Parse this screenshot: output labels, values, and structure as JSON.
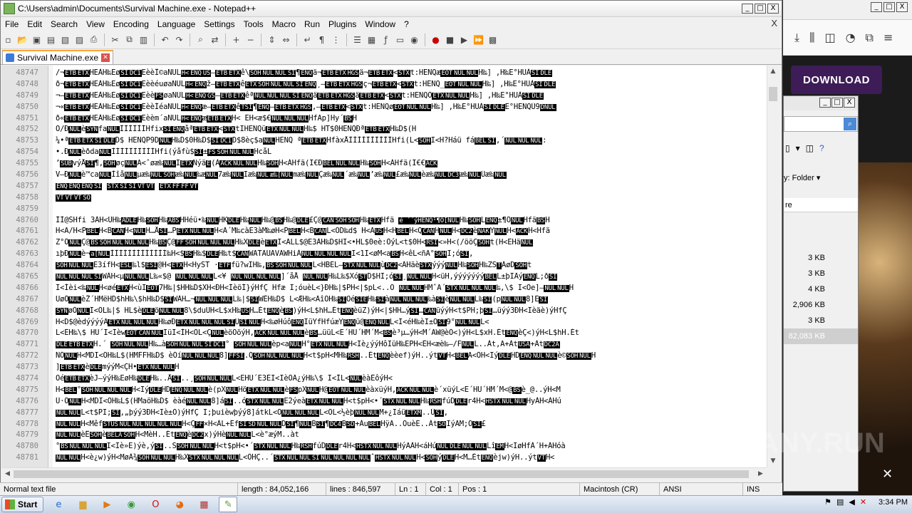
{
  "window": {
    "title": "C:\\Users\\admin\\Documents\\Survival Machine.exe - Notepad++",
    "controls": [
      "_",
      "□",
      "X"
    ]
  },
  "menu": [
    "File",
    "Edit",
    "Search",
    "View",
    "Encoding",
    "Language",
    "Settings",
    "Tools",
    "Macro",
    "Run",
    "Plugins",
    "Window",
    "?"
  ],
  "menu_close": "X",
  "toolbar_icons": [
    "new-icon",
    "open-icon",
    "save-icon",
    "save-all-icon",
    "close-icon",
    "close-all-icon",
    "print-icon",
    "cut-icon",
    "copy-icon",
    "paste-icon",
    "undo-icon",
    "redo-icon",
    "find-icon",
    "replace-icon",
    "zoom-in-icon",
    "zoom-out-icon",
    "sync-v-icon",
    "sync-h-icon",
    "wrap-icon",
    "all-chars-icon",
    "indent-guide-icon",
    "udl-icon",
    "doc-map-icon",
    "function-list-icon",
    "folder-workspace-icon",
    "monitor-icon",
    "record-icon",
    "stop-icon",
    "play-icon",
    "play-multiple-icon",
    "save-macro-icon"
  ],
  "tab": {
    "label": "Survival Machine.exe"
  },
  "editor": {
    "lines": [
      {
        "n": "48747",
        "t": "/¬[ETB][ETX]HEÀH‰Eø[SI][DC1]EèèÎ©aNUL[H<][ENQ][US]–[ETB][ETX]ê\\[SOH][NUL][NUL][SI]¶[ENQ]ä¬[ETB][ETX][HGS]ä¬[ETB][ETX]<[STX]t:HENQæ[EOT][NUL][NUL]H‰] ,H‰E°HUÀ[SI][DLE]"
      },
      {
        "n": "48748",
        "t": "ð¬[ETB][ETX]HEÀH‰Eø[SI][DC1]EèèéuøaNUL[H<][ENQ]ž–[ETB][ETX]ê[ETX][SOH][NUL][NUL][SI][ENQ]¸–[ETB][ETX][HGS]ç¬[ETB][ETX]<[STX]t:HENQ_[EOT][NUL][NUL]H‰] ,H‰E°HUÀ[SI][DLE]"
      },
      {
        "n": "48749",
        "t": "¬–[ETB][ETX]HEÀH‰Eø[SI][DC1]Eèè[FS]øaNUL[H<][ENQ][GS]–[ETB][ETX]êª[NUL][NUL][NUL][SI][ENQ]ä[ETB][ETX][HGS]ä[ETB][ETX]<[STX]t:HENQÖ[ETX][NUL][NUL]H‰] ,H‰E°HUÀ[SI][DLE]"
      },
      {
        "n": "48750",
        "t": "¬«[ETB][ETX]HEÀH‰Eø[SI][DC1]EèèÍéaNUL[H<][ENQ]æ–[ETB][ETX]ê[TSI]¶[ENQ]–[ETB][ETX][HGS],–[ETB][ETX]<[STX]t:HENQø[EOT][NUL][NUL]H‰] ,H‰E°HUÀ[SI][DLE]E°HENQÙ9[DNUL]"
      },
      {
        "n": "48751",
        "t": "ð«[ETB][ETX]HEÀH‰Eø[SI][DC1]Eèèm´aNUL[H<][ENQ]æ[ETB][ETX]H< ËH<æ$€[NUL][NUL][NUL]HfAp]Hy´[BS]H"
      },
      {
        "n": "48752",
        "t": "Ó/Ð[NUL]è[SYN]fa[NUL]ÌÌÌÌÌÌHfix[SI][ENQ]åª[ETB][ETX]<[STX]tIHENQü[ETX][NUL][NUL]H‰$ HT$0HENQÐª[ETB][ETX]H‰D$(H"
      },
      {
        "n": "48753",
        "t": "¼•ª[ETB][ETX][SI][DLE]D$ HENQP9D[NUL]H‰D$0H‰D$[SI][DC1]D$8èç$a[NUL]HENQ ª[ETB][ETX]HfàxÅÌÌÌÌÌÌÌÌÌÌHfi(L<[SOH]I<H?Háü fá[BEL][SI],´[NUL][NUL][NUL]:"
      },
      {
        "n": "48754",
        "t": "•.Ð[NUL]èðda[NUL]ÌÌÌÌÌÌÌÌÌÌHfi(ýåfù$[SI]±[FS][SOH][NUL][NUL]HcåL"
      },
      {
        "n": "48755",
        "t": "’[SUB]výÅ[SI]¶,[SOH]øç[NUL]A<ˆøæ‰[NUL]I[ETX]Ñýä[E](À[ACK][NUL][NUL]H‰[SOH]H<ÁHfä(Ï€Ð[BEL][NUL][NUL]H‰[SOH]H<ÁHfä(Ï€€[ACK]"
      },
      {
        "n": "48756",
        "t": "V–Ð[NUL]è™ca[NUL]Ìîå[NUL]µæ‰[NUL][SOH]æ‰[NUL]‰æ[NUL]7æ‰[NUL]Iæ‰[NUL][æ‰[NUL]mæ‰[NUL]Çæ‰[NUL]´æ‰[NUL]’æ‰[NUL]£æ‰[NUL]èæ‰[NUL][DC3]æ‰[NUL]Üæ‰[NUL]"
      },
      {
        "n": "48757",
        "t": "[ENQ][ENQ][ENQ][SI] [STX][SI][SI][VT][VT]    [ETX][FF][FF][VT]"
      },
      {
        "n": "48758",
        "t": "[VT][VT][VT][SO]"
      },
      {
        "n": "48759",
        "t": ""
      },
      {
        "n": "48760",
        "t": "ÌÌ@SHfi 3ÀH<ÙH‰[ADLE]H‰[SOH]H‰[ABS]HHéü•‰[NUL]HK[DLE]H‰[NUL]H‰@[BS]H‰@[DLE]£Ç@[CAN][SOH][SOH]H‰[ETX]Hfä [é ´´ýHENQ¹¶Ô[NUL]H‰[SOH]L[ENQ]±¶Ô[NUL]Hfä[BS]H"
      },
      {
        "n": "48761",
        "t": "H<A/H<P[BEL]H<B[CAN]H<[NUL]H…Å[SI]…P[ETX][NUL][NUL]H<A´M‰càE3àM‰øH<P[BEL]H<B[CAN]L<OD‰d$ H<A[US]H<H[BEL]H<Q[CAN]H[NUL]H<[DC2]è[NAK]Y[NUL]H<[ACK]H<Hfä"
      },
      {
        "n": "48762",
        "t": "Z°Ô[NUL]Ç@[BS][SOH][NUL][NUL][NUL]H‰[BS]Ç@[FF][SOH][NUL][NUL][NUL]H‰X[DLE]è[ETX]I<ÄLL$@E3ÀH‰D$HI<•HL$0eè:ÖýL<t$0H<[RSI]<»H<(/ööÇ[SOH]t(H<ËHä[NUL]"
      },
      {
        "n": "48763",
        "t": "ıþÐ[NUL]è¬[a[NUL]ÌÌÌÌÌÌÌÌÌÌÌÌÌ‰H<$[BS]H‰$[DLE]H‰t$[CAN]WATAUAVAWHiÀ[NUL][NUL][NUL][NUL]I<1I<øM<a[BS]H<êL<ñA°[SOH]I;ó[SI],"
      },
      {
        "n": "48764",
        "t": "[SOH][NUL][NUL]E3ífH<[ESL]‰l$[ESI]@H<[ETX]H<HyST ·[ETF]fü?wIH‰,[BS][SOH][NUL][NUL]L<HBEL–[STX][NUL][NUL]ù[DC2]<ÁHäè[STX]ýýý[NUL]H‰[SOH]H‰ZS[T]ÁøD[SOH]t"
      },
      {
        "n": "48765",
        "t": "[NUL][NUL][NUL][SI]WÀH<µ[NUL][NUL]L‰«$@    [NUL][NUL][NUL]L<¥ [NUL][NUL][NUL][NUL]]´åÅ [NUL][NUL]H‰L‰$Xó[ST]D$HI;ó[SI]¸[NUL][NUL]H<üH,ýýýýýýý[BEL]L±þIÄý[ENQ]L;ð[SI]"
      },
      {
        "n": "48766",
        "t": "I<Ìèi<‰[NUL]H<øé[ETX]H<ùI[EOT]7H‰|$HH‰D$XH<ÐH<ÌèöÍ}ýHfÇ Hfæ I;óuèL<}ÐH‰|$PH<|$pL<..O   [NUL][NUL]HMˆA´[STX][NUL][NUL][NUL]‰,\\$ I<Öe]–[NUL][NUL]H"
      },
      {
        "n": "48767",
        "t": "UøÖ[NUL]èŽ´HMëHD$hH‰\\$hH‰D$[SI]WÀH…¬[NUL][NUL][NUL]L‰|$[SI]WÉH‰D$ L<ÆH‰<ÄîÕH‰[SI]Oé[SIE]H‰[SI]à[NUL][NUL][NUL]‰à[SI]è[NUL][NUL]L‰[SI](p[NUL][NUL]8]Ë[SI]"
      },
      {
        "n": "48768",
        "t": "[SYN]øÖ[NUL]I<ÖL‰|$ HL$è[DLE]ö[NUL][NUL]8\\$duUH<L$xH‰[US]H…Ét[ENQ]è[BS])ýH<L$hH…Ét[ENQ]èüZ)ýH<|$HH…ý[SI]…[CAN]üýýH<t$PH;þ[SI]…üýý3ÐH<Ièäè)ýHfÇ"
      },
      {
        "n": "48769",
        "t": "H<D$@èdýýýýÄ[ETX][NUL][NUL][NUL]H‰øÐ[ETX][NUL][NUL][NUL][SI]U[SI][NUL]H<‰øHúô[ENQ]IüYfHfúæY[ENQ]ü@[ENQ][NUL]L<I<éH‰èI±O[SI]9°[NUL][NUL]L<"
      },
      {
        "n": "48770",
        "t": "L<ËH‰\\$ HU´I<Ïèw[EOT][CAN][NUL]IüI<ÌH<ÖL<Ç[NUL]èöÕöýH,[ACK][NUL][NUL][NUL]è[BS]…üüL<E´HU´HM´M<[BS]è³µ…ýH<M´AW@èÖ<)ýH<L$xH.Ét[ENQ]èÇ<)ýH<L$hH.Ét"
      },
      {
        "n": "48771",
        "t": "[DLE][ETB][ETX]H.´ [SOH][NUL][NUL]H‰…à[SOH][NUL][NUL][SI][DC1]° [SOH][NUL][NUL]èp<a[NUL]H°[ETX][NUL][NUL]H<Iè¿ýýHôIüH‰EPH<ÈH<æè‰–/F[NUL]L..Àt,A+Àt[USA]+Àt[DC2A]"
      },
      {
        "n": "48772",
        "t": "ÑÖ[NUL]H<MDI<ÕH‰L$(HMFFH‰D$ èÖí[NUL][NUL][NUL]8][FFSI].Q[SOH][NUL][NUL][NUL]H<t$pH<MH‰[RSH]..Ét[ENQ]èèef)ýH..ýt[VT]H<[BEL]A<ÖH<Iý[DLE]HD[ENQ][NUL][NUL]è©[SOH][NUL]H"
      },
      {
        "n": "48773",
        "t": "][ETB][ETX]è[DLE]mýýM<ÇH•[ETX][NUL][NUL]H"
      },
      {
        "n": "48774",
        "t": "Oé[ETB][ETX]èJ–ýýH‰EøH‰[DLE]H‰..Å[SI]..¸[SOH][NUL][NUL]L<EHU´E3ÉI<IèÖÄ¿ýH‰\\$ I<ÍL<[NUL]èàÈôýH<"
      },
      {
        "n": "48775",
        "t": "H<[BEL]°[SOH][NUL][NUL][NUL]H<Iý[DLE]HD[ENQ][NUL][NUL]è(pX[NUL]Hö[ETX][NUL][NUL]è[FS]pX[NUL]H@[EOT][NUL][NUL]èàxüýH,[ACK][NUL][NUL]è´xüýL<E´HU´HM´M<@[BS]è_@..ýH<M"
      },
      {
        "n": "48776",
        "t": "Ü·Ö[NUL]H<MDI<ÕH‰L$(HMaöH‰D$ èàé[NUL][NUL]8]á[SI]..ó[STX][NUL][NUL]E2ýeà[ETX][NUL][NUL]H<t$pH<•´[STX][NUL][NUL]H‰[RSH]fúD[DLE]r4H<[HSTX][NUL][NUL]HyÀH<ÀHú"
      },
      {
        "n": "48777",
        "t": "[NUL][NUL]L<t$PI;[SI],„þýý3ÐH<Iè±Õ)ýHfÇ I;þuièwþýý8]átkL<Ö[NUL][NUL][NUL]L<ÖL<½èþ[NUL][NUL]M+¿Iáü[ETXM]..Ù[SI],"
      },
      {
        "n": "48778",
        "t": "[NUL][NUL]H<Mêf[STUS][NUL][NUL][NUL][NUL][NUL]H<Ç[FF]×H<ÁL+Éf[SI][SD][NUL][NUL]D[SI]¶[NUL]B[SI]¶[DC4]B[SD]+Áu[BEL]HÿA..ÖuèE..Àt[SO]IýAM;Ó[SI]£"
      },
      {
        "n": "48779",
        "t": "[NUL][NUL]èÊ[SOH]è[BELA][SOH]H<MèH..Ét[ENQ]è[DC2]x)ýHè[NUL][NUL]L<è°æýM..àt"
      },
      {
        "n": "48780",
        "t": "°[BS][NUL][NUL][NUL]I<Iè»E)ýè,ý[SI]..S[SOH][NUL][NUL]H<t$pH<•´[STX][NUL][NUL]H‰[RSH]fúD[DLE]r4H<[HSTX][NUL][NUL]HýAÀH<áHú[NUL][DLE][NUL][NUL]Lî[EM]H<IøHfÀ´H+ÁHóà"
      },
      {
        "n": "48781",
        "t": "[NUL][NUL]H<è¿w)ýH<MøÀ¾[SOH][NUL][NUL]H‰X[STX][NUL][NUL][NUL]L<ÖHÇ..´[STX][NUL][NUL][SI][NUL][NUL][NUL][NUL]ˆ[HSTX][NUL][NUL]H<[SOH]ý[DLE]H<M…Ét[ENQ]èjw)ýH..ýt[VT]H<"
      }
    ]
  },
  "status": {
    "type": "Normal text file",
    "length": "length : 84,052,166",
    "lines": "lines : 846,597",
    "ln": "Ln : 1",
    "col": "Col : 1",
    "pos": "Pos : 1",
    "eol": "Macintosh (CR)",
    "encoding": "ANSI",
    "mode": "INS"
  },
  "browser": {
    "download_label": "DOWNLOAD",
    "watermark": "ANY.RUN"
  },
  "explorer": {
    "view_label": "y: Folder",
    "column_label": "re",
    "sizes": [
      "3 KB",
      "3 KB",
      "4 KB",
      "2,906 KB",
      "3 KB",
      "82,083 KB"
    ]
  },
  "taskbar": {
    "start_label": "Start",
    "time": "3:34 PM"
  }
}
